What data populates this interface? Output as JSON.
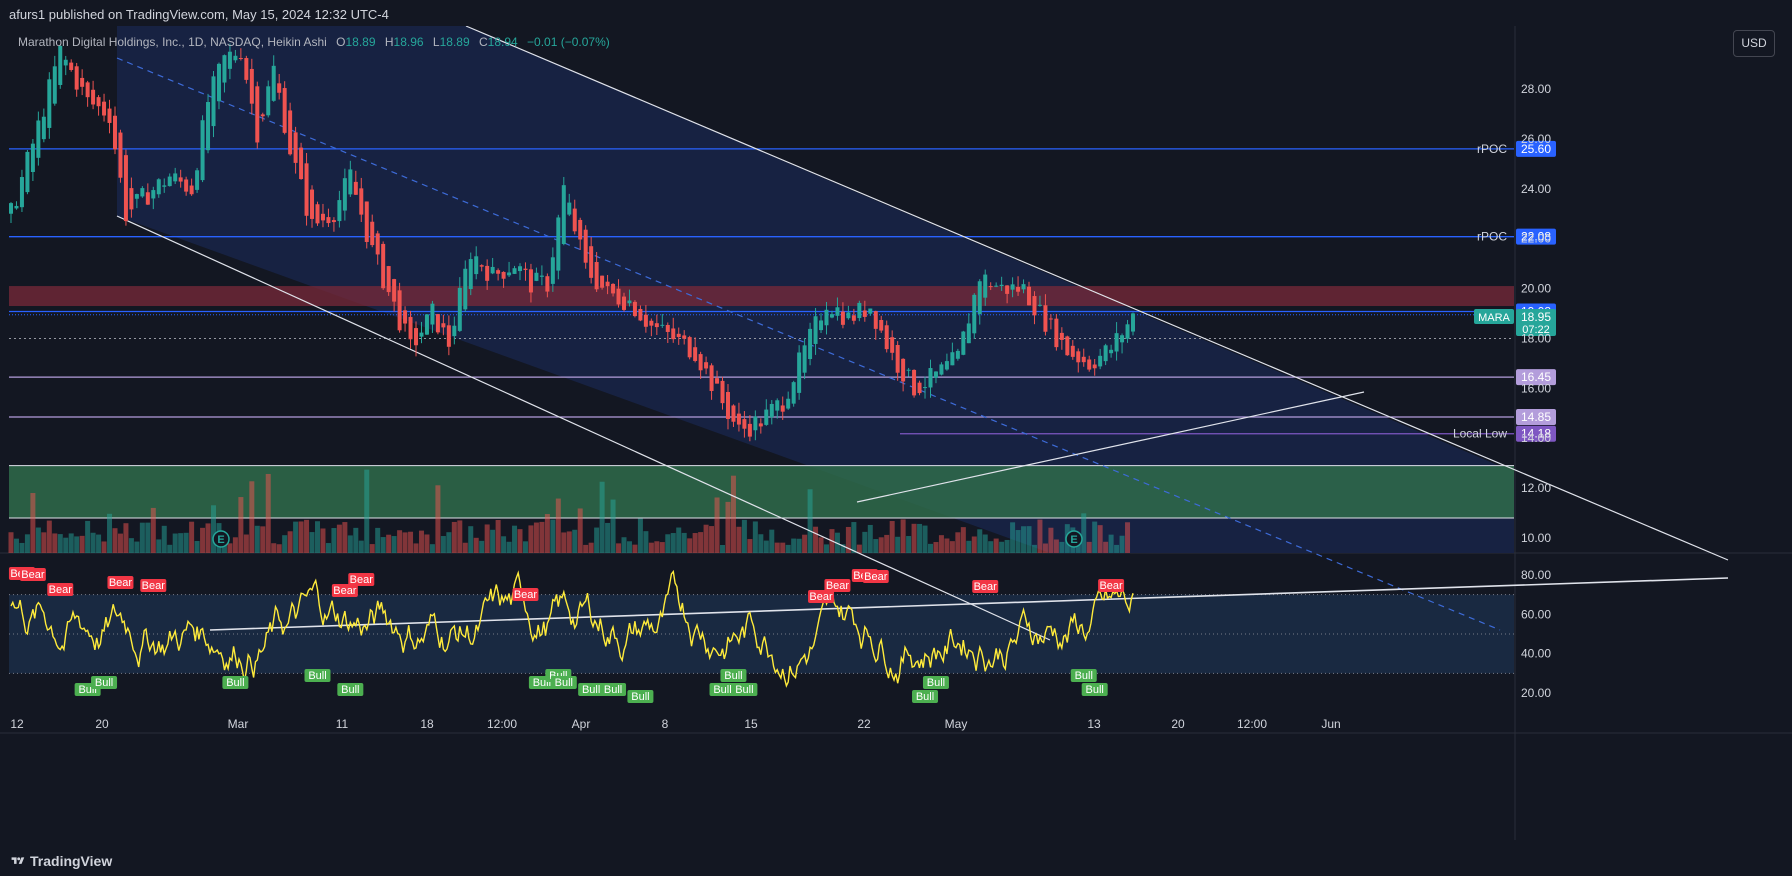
{
  "header": {
    "published": "afurs1 published on TradingView.com, May 15, 2024 12:32 UTC-4"
  },
  "legend": {
    "symbol": "Marathon Digital Holdings, Inc., 1D, NASDAQ, Heikin Ashi",
    "o_label": "O",
    "o": "18.89",
    "h_label": "H",
    "h": "18.96",
    "l_label": "L",
    "l": "18.89",
    "c_label": "C",
    "c": "18.94",
    "change": "−0.01 (−0.07%)"
  },
  "currency_button": "USD",
  "footer": {
    "brand": "TradingView"
  },
  "colors": {
    "background": "#131722",
    "up": "#26a69a",
    "down": "#ef5350",
    "channel_fill": "#172345",
    "supply_zone": "#7a2a3a",
    "demand_zone": "#2f6b4a",
    "level_blue": "#2962ff",
    "level_purple": "#b39ddb",
    "oscillator": "#ffeb3b",
    "bear_label": "#f23645",
    "bull_label": "#4caf50"
  },
  "chart_data": [
    {
      "type": "candlestick",
      "title": "Marathon Digital Holdings, Inc., 1D, NASDAQ, Heikin Ashi",
      "x_tick_labels": [
        "12",
        "20",
        "Mar",
        "11",
        "18",
        "12:00",
        "Apr",
        "8",
        "15",
        "22",
        "May",
        "13",
        "20",
        "12:00",
        "Jun"
      ],
      "y_tick_labels": [
        "28.00",
        "26.00",
        "24.00",
        "22.00",
        "20.00",
        "18.00",
        "16.00",
        "14.00",
        "12.00",
        "10.00"
      ],
      "ylim": [
        9.5,
        30.5
      ],
      "grid": false,
      "close_path": [
        [
          0,
          23.0
        ],
        [
          5,
          26.5
        ],
        [
          9,
          29.5
        ],
        [
          14,
          27.5
        ],
        [
          18,
          27.0
        ],
        [
          21,
          23.0
        ],
        [
          25,
          23.8
        ],
        [
          29,
          24.5
        ],
        [
          33,
          24.0
        ],
        [
          36,
          27.5
        ],
        [
          39,
          29.2
        ],
        [
          42,
          29.6
        ],
        [
          45,
          26.3
        ],
        [
          48,
          28.8
        ],
        [
          51,
          25.6
        ],
        [
          55,
          22.5
        ],
        [
          59,
          23.1
        ],
        [
          62,
          24.5
        ],
        [
          66,
          21.5
        ],
        [
          70,
          19.3
        ],
        [
          73,
          17.6
        ],
        [
          77,
          19.0
        ],
        [
          80,
          17.8
        ],
        [
          84,
          21.5
        ],
        [
          88,
          20.5
        ],
        [
          92,
          21.0
        ],
        [
          95,
          20.2
        ],
        [
          98,
          20.2
        ],
        [
          101,
          24.0
        ],
        [
          105,
          20.8
        ],
        [
          109,
          19.8
        ],
        [
          113,
          19.5
        ],
        [
          117,
          18.5
        ],
        [
          121,
          18.0
        ],
        [
          125,
          17.5
        ],
        [
          129,
          15.8
        ],
        [
          133,
          14.3
        ],
        [
          137,
          14.7
        ],
        [
          141,
          15.5
        ],
        [
          145,
          17.5
        ],
        [
          149,
          19.5
        ],
        [
          153,
          18.8
        ],
        [
          157,
          19.3
        ],
        [
          161,
          17.3
        ],
        [
          165,
          16.0
        ],
        [
          169,
          16.5
        ],
        [
          173,
          17.2
        ],
        [
          177,
          20.5
        ],
        [
          181,
          20.0
        ],
        [
          185,
          20.0
        ],
        [
          189,
          18.7
        ],
        [
          193,
          17.5
        ],
        [
          197,
          17.0
        ],
        [
          201,
          17.6
        ],
        [
          205,
          18.9
        ]
      ],
      "horizontal_levels": [
        {
          "label": "rPOC",
          "value": 25.6,
          "color": "#2962ff"
        },
        {
          "label": "rPOC",
          "value": 22.08,
          "color": "#2962ff"
        },
        {
          "label": "",
          "value": 19.08,
          "color": "#2962ff"
        },
        {
          "label": "",
          "value": 16.45,
          "color": "#b39ddb"
        },
        {
          "label": "",
          "value": 14.85,
          "color": "#b39ddb"
        },
        {
          "label": "Local Low",
          "value": 14.18,
          "color": "#7e57c2"
        }
      ],
      "last_price": {
        "symbol": "MARA",
        "value": "18.95",
        "countdown": "07:22"
      },
      "zones": [
        {
          "name": "supply",
          "from": 19.3,
          "to": 20.1
        },
        {
          "name": "demand",
          "from": 10.8,
          "to": 12.9
        }
      ],
      "earnings_markers": [
        "E",
        "E"
      ]
    },
    {
      "type": "line",
      "name": "oscillator",
      "y_tick_labels": [
        "80.00",
        "60.00",
        "40.00",
        "20.00"
      ],
      "ylim": [
        12,
        92
      ],
      "bands": [
        30,
        50,
        70
      ],
      "signals": [
        {
          "label": "Bear",
          "x": 2
        },
        {
          "label": "Bear",
          "x": 4
        },
        {
          "label": "Bear",
          "x": 9
        },
        {
          "label": "Bear",
          "x": 20
        },
        {
          "label": "Bear",
          "x": 26
        },
        {
          "label": "Bear",
          "x": 61
        },
        {
          "label": "Bear",
          "x": 64
        },
        {
          "label": "Bear",
          "x": 94
        },
        {
          "label": "Bear",
          "x": 148
        },
        {
          "label": "Bear",
          "x": 151
        },
        {
          "label": "Bear",
          "x": 156
        },
        {
          "label": "Bear",
          "x": 158
        },
        {
          "label": "Bear",
          "x": 178
        },
        {
          "label": "Bear",
          "x": 201
        },
        {
          "label": "Bull",
          "x": 14
        },
        {
          "label": "Bull",
          "x": 17
        },
        {
          "label": "Bull",
          "x": 41
        },
        {
          "label": "Bull",
          "x": 56
        },
        {
          "label": "Bull",
          "x": 62
        },
        {
          "label": "Bull",
          "x": 97
        },
        {
          "label": "Bull",
          "x": 100
        },
        {
          "label": "Bull",
          "x": 101
        },
        {
          "label": "Bull",
          "x": 106
        },
        {
          "label": "Bull",
          "x": 110
        },
        {
          "label": "Bull",
          "x": 115
        },
        {
          "label": "Bull",
          "x": 130
        },
        {
          "label": "Bull",
          "x": 132
        },
        {
          "label": "Bull",
          "x": 134
        },
        {
          "label": "Bull",
          "x": 167
        },
        {
          "label": "Bull",
          "x": 169
        },
        {
          "label": "Bull",
          "x": 196
        },
        {
          "label": "Bull",
          "x": 198
        }
      ]
    }
  ]
}
